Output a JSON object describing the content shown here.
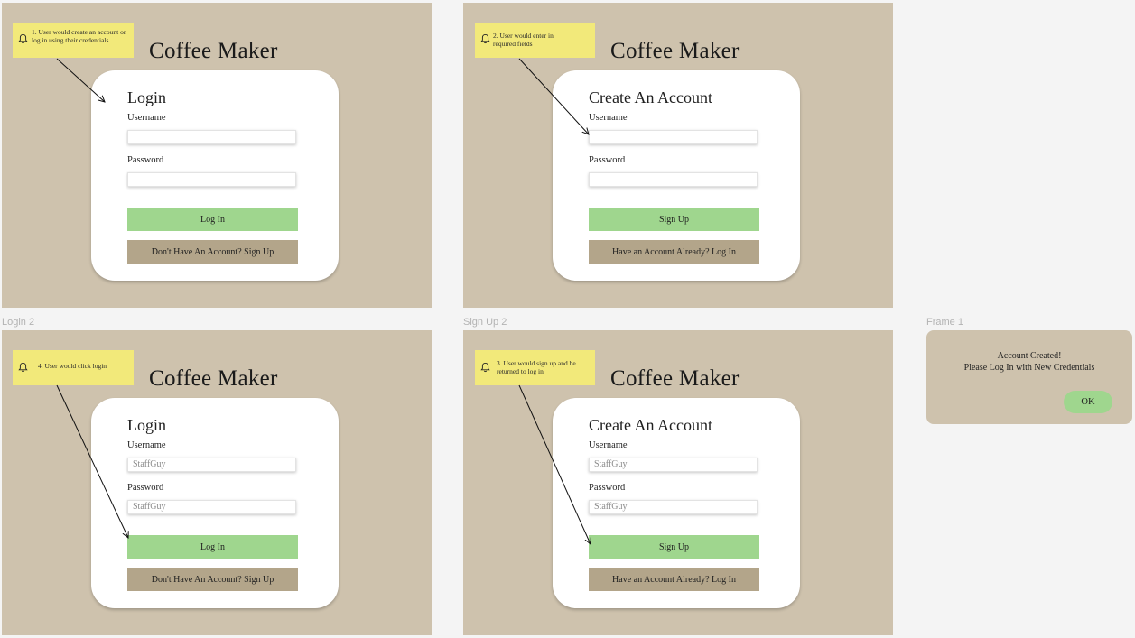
{
  "frame_labels": {
    "login2": "Login 2",
    "signup2": "Sign Up 2",
    "frame1": "Frame 1"
  },
  "app_title": "Coffee Maker",
  "login": {
    "heading": "Login",
    "username_label": "Username",
    "password_label": "Password",
    "primary_button": "Log In",
    "secondary_button": "Don't Have An Account? Sign Up"
  },
  "signup": {
    "heading": "Create An Account",
    "username_label": "Username",
    "password_label": "Password",
    "primary_button": "Sign Up",
    "secondary_button": "Have an Account Already? Log In"
  },
  "filled_values": {
    "username": "StaffGuy",
    "password": "StaffGuy"
  },
  "notes": {
    "step1": "1. User would create an account or log in using their credentials",
    "step2": "2. User would enter in required fields",
    "step3": "3. User would sign up and be returned to log in",
    "step4": "4. User would click login"
  },
  "dialog": {
    "line1": "Account Created!",
    "line2": "Please Log In with New Credentials",
    "ok": "OK"
  },
  "colors": {
    "frame_bg": "#cec2ad",
    "primary_button": "#9fd68e",
    "secondary_button": "#b3a58a",
    "sticky_note": "#f2e97a"
  },
  "icons": {
    "note": "bell-icon"
  }
}
